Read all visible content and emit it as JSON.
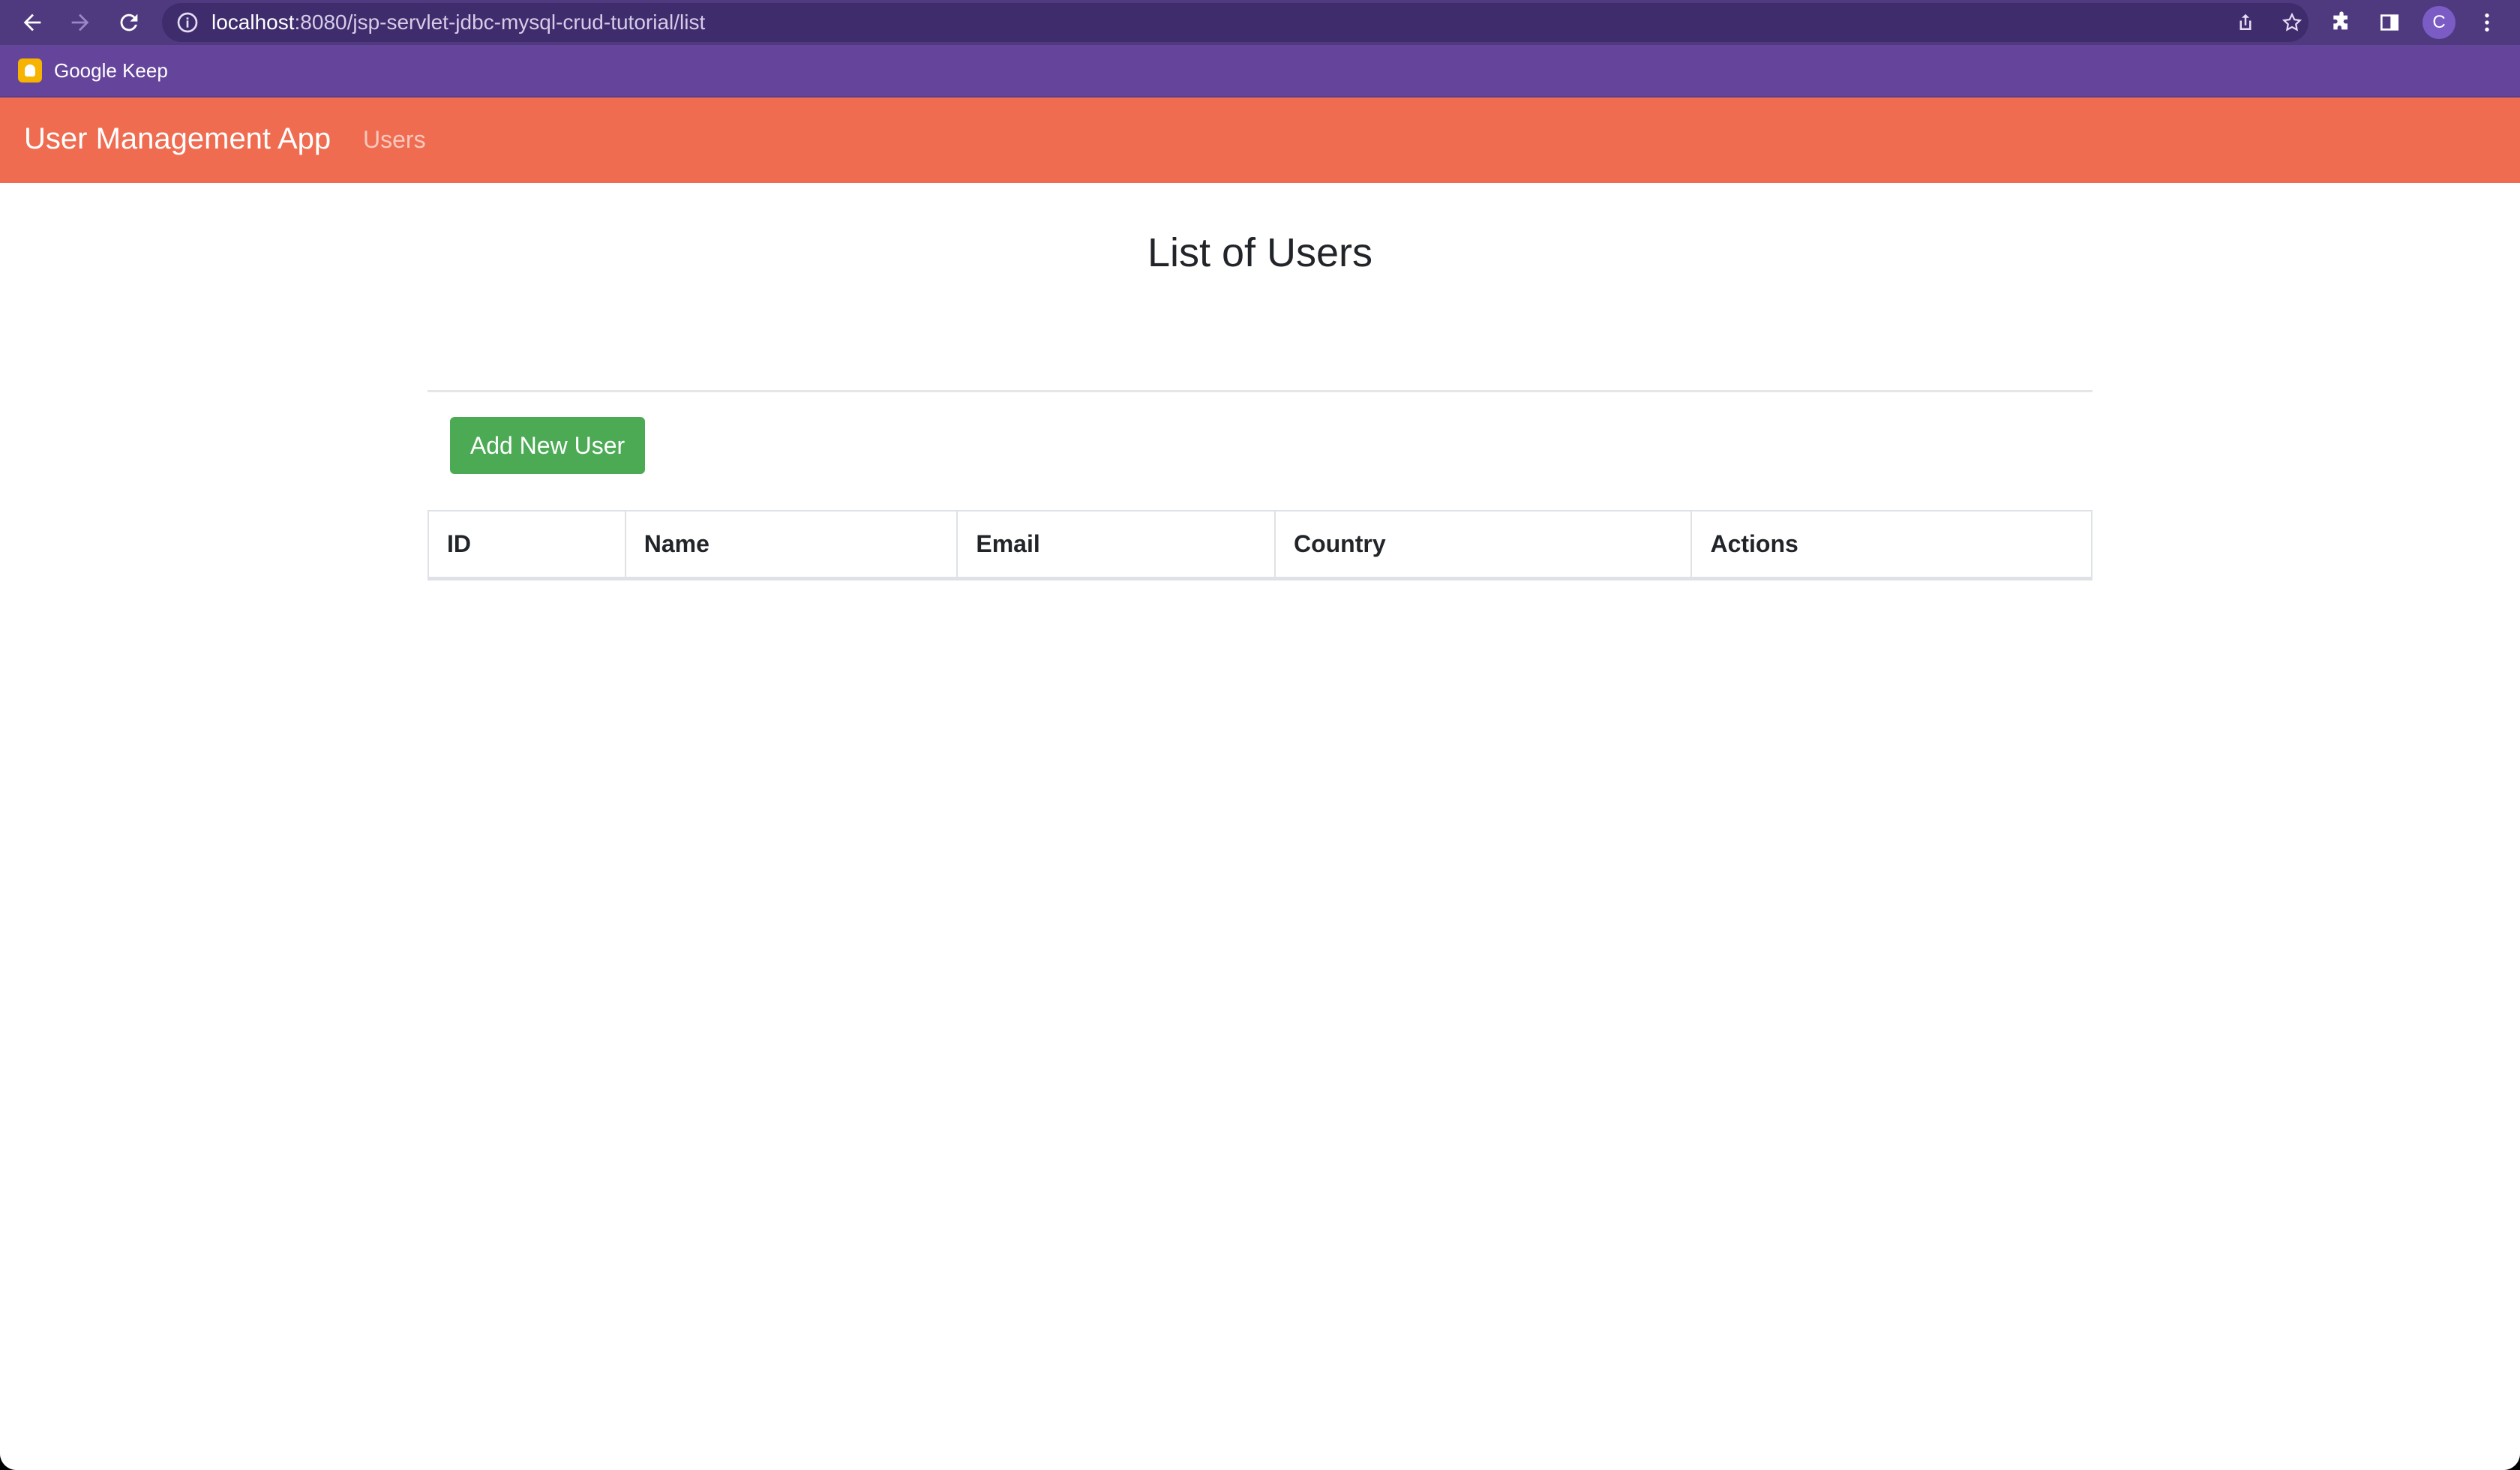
{
  "browser": {
    "url_host": "localhost",
    "url_rest": ":8080/jsp-servlet-jdbc-mysql-crud-tutorial/list",
    "profile_initial": "C",
    "bookmarks": [
      {
        "label": "Google Keep",
        "icon": "google-keep-icon"
      }
    ],
    "colors": {
      "toolbar": "#4f3a80",
      "omnibox": "#3e2c6c",
      "bookmarks_bar": "#65459b"
    }
  },
  "navbar": {
    "brand": "User Management App",
    "links": [
      {
        "label": "Users"
      }
    ],
    "color": "#ef6c51"
  },
  "main": {
    "title": "List of Users",
    "add_button_label": "Add New User",
    "add_button_color": "#4caa55",
    "table": {
      "columns": [
        "ID",
        "Name",
        "Email",
        "Country",
        "Actions"
      ],
      "rows": []
    }
  }
}
